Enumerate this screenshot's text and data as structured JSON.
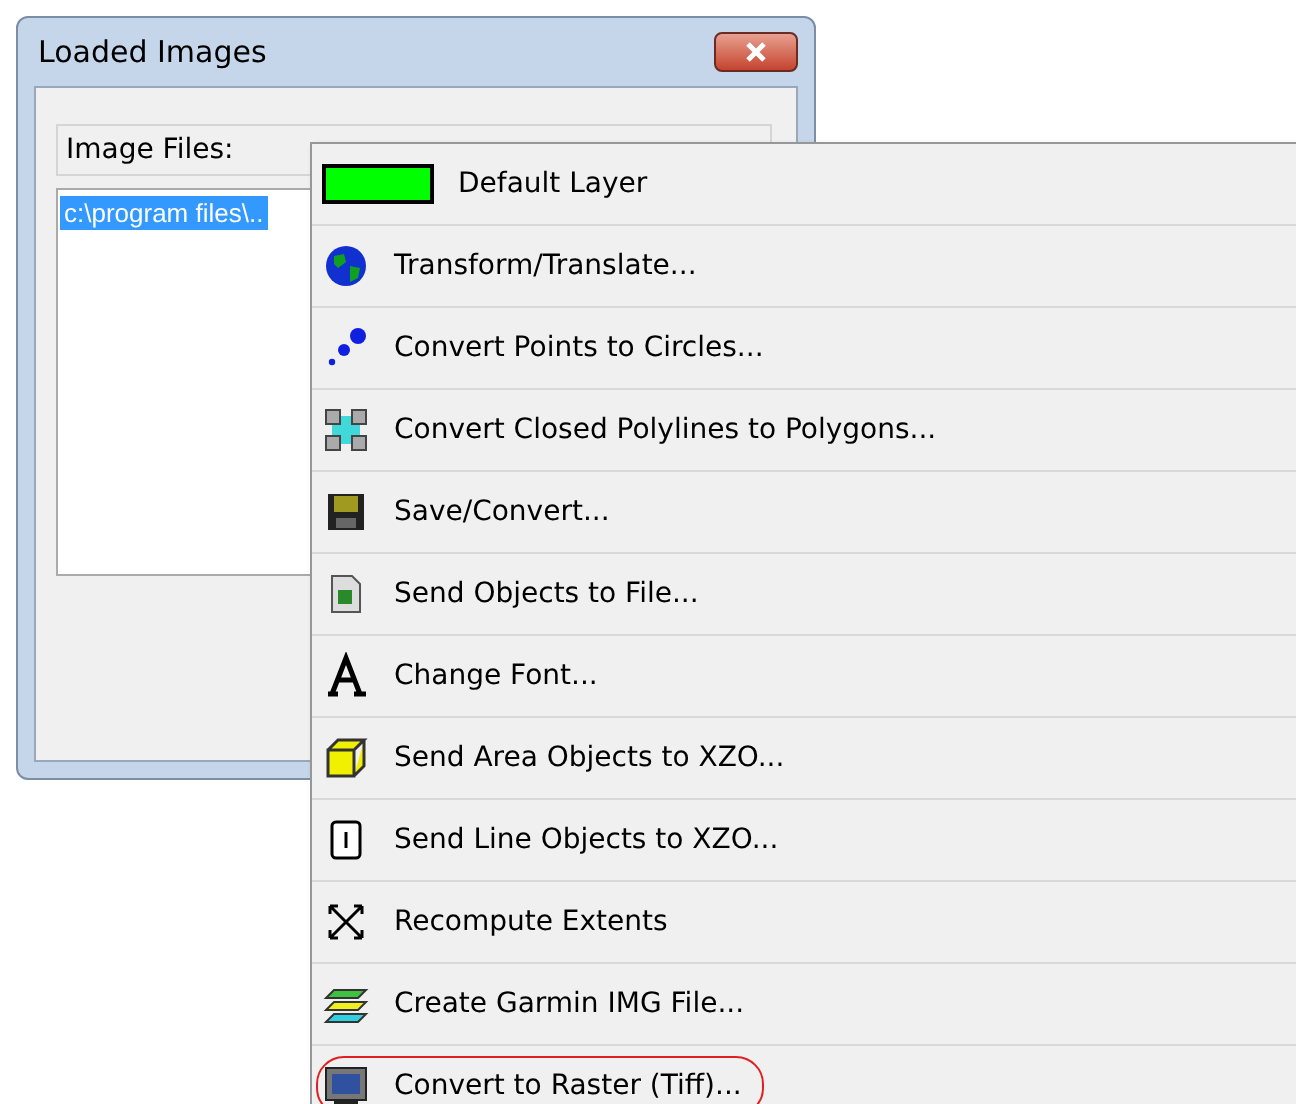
{
  "dialog": {
    "title": "Loaded Images",
    "group_label": "Image Files:",
    "files": [
      {
        "text": "c:\\program files\\..",
        "selected": true
      }
    ]
  },
  "menu": {
    "items": [
      {
        "label": "Default Layer",
        "kind": "swatch",
        "color": "#00ff00",
        "circled": false
      },
      {
        "label": "Transform/Translate...",
        "kind": "globe",
        "circled": false
      },
      {
        "label": "Convert Points to Circles...",
        "kind": "points",
        "circled": false
      },
      {
        "label": "Convert Closed Polylines to Polygons...",
        "kind": "polygon",
        "circled": false
      },
      {
        "label": "Save/Convert...",
        "kind": "disk",
        "circled": false
      },
      {
        "label": "Send Objects to File...",
        "kind": "file",
        "circled": false
      },
      {
        "label": "Change Font...",
        "kind": "font",
        "circled": false
      },
      {
        "label": "Send Area Objects to XZO...",
        "kind": "cube",
        "circled": false
      },
      {
        "label": "Send Line Objects to XZO...",
        "kind": "line",
        "circled": false
      },
      {
        "label": "Recompute Extents",
        "kind": "extents",
        "circled": false
      },
      {
        "label": "Create Garmin IMG File...",
        "kind": "layers",
        "circled": false
      },
      {
        "label": "Convert to Raster (Tiff)...",
        "kind": "raster",
        "circled": true
      }
    ]
  }
}
